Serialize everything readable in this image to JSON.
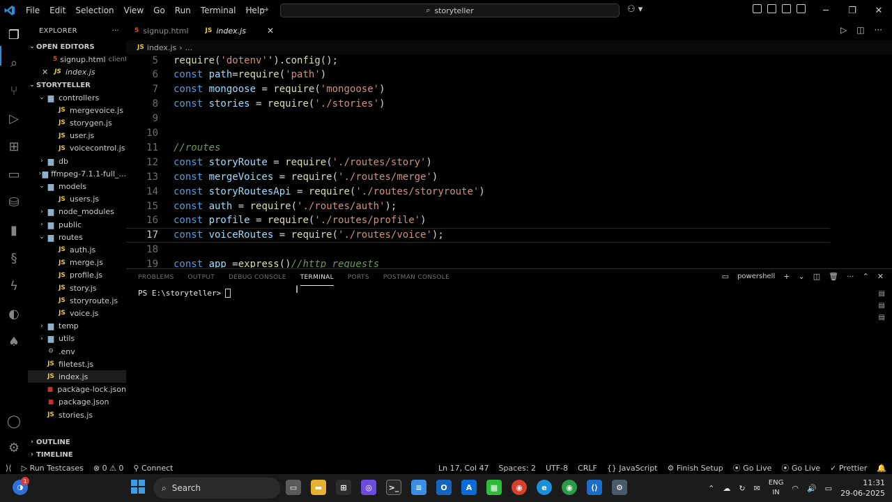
{
  "titlebar": {
    "menu": [
      "File",
      "Edit",
      "Selection",
      "View",
      "Go",
      "Run",
      "Terminal",
      "Help"
    ],
    "search": "storyteller"
  },
  "sidebar": {
    "title": "EXPLORER",
    "open_editors_label": "OPEN EDITORS",
    "open_editors": [
      {
        "name": "signup.html",
        "hint": "client"
      },
      {
        "name": "index.js",
        "hint": ""
      }
    ],
    "project_label": "STORYTELLER",
    "tree": [
      {
        "label": "controllers",
        "type": "folder",
        "open": true,
        "depth": 1
      },
      {
        "label": "mergevoice.js",
        "type": "js",
        "depth": 2
      },
      {
        "label": "storygen.js",
        "type": "js",
        "depth": 2
      },
      {
        "label": "user.js",
        "type": "js",
        "depth": 2
      },
      {
        "label": "voicecontrol.js",
        "type": "js",
        "depth": 2
      },
      {
        "label": "db",
        "type": "folder",
        "open": false,
        "depth": 1
      },
      {
        "label": "ffmpeg-7.1.1-full_...",
        "type": "folder",
        "open": false,
        "depth": 1
      },
      {
        "label": "models",
        "type": "folder",
        "open": true,
        "depth": 1
      },
      {
        "label": "users.js",
        "type": "js",
        "depth": 2
      },
      {
        "label": "node_modules",
        "type": "folder",
        "open": false,
        "depth": 1
      },
      {
        "label": "public",
        "type": "folder",
        "open": false,
        "depth": 1
      },
      {
        "label": "routes",
        "type": "folder",
        "open": true,
        "depth": 1
      },
      {
        "label": "auth.js",
        "type": "js",
        "depth": 2
      },
      {
        "label": "merge.js",
        "type": "js",
        "depth": 2
      },
      {
        "label": "profile.js",
        "type": "js",
        "depth": 2
      },
      {
        "label": "story.js",
        "type": "js",
        "depth": 2
      },
      {
        "label": "storyroute.js",
        "type": "js",
        "depth": 2
      },
      {
        "label": "voice.js",
        "type": "js",
        "depth": 2
      },
      {
        "label": "temp",
        "type": "folder",
        "open": false,
        "depth": 1
      },
      {
        "label": "utils",
        "type": "folder",
        "open": false,
        "depth": 1
      },
      {
        "label": ".env",
        "type": "env",
        "depth": 1
      },
      {
        "label": "filetest.js",
        "type": "js",
        "depth": 1
      },
      {
        "label": "index.js",
        "type": "js",
        "depth": 1,
        "selected": true
      },
      {
        "label": "package-lock.json",
        "type": "json",
        "depth": 1
      },
      {
        "label": "package.json",
        "type": "json",
        "depth": 1
      },
      {
        "label": "stories.js",
        "type": "js",
        "depth": 1
      }
    ],
    "outline_label": "OUTLINE",
    "timeline_label": "TIMELINE"
  },
  "tabs": [
    {
      "label": "signup.html",
      "active": false
    },
    {
      "label": "index.js",
      "active": true
    }
  ],
  "breadcrumb": {
    "file": "index.js",
    "more": "..."
  },
  "editor": {
    "current_line": 17,
    "lines": [
      {
        "n": 5,
        "tokens": [
          [
            "fn",
            "require"
          ],
          [
            "p",
            "("
          ],
          [
            "str",
            "'dotenv'"
          ],
          [
            "p",
            "')."
          ],
          [
            "fn",
            "config"
          ],
          [
            "p",
            "();"
          ]
        ]
      },
      {
        "n": 6,
        "tokens": [
          [
            "kw",
            "const "
          ],
          [
            "var",
            "path"
          ],
          [
            "p",
            "="
          ],
          [
            "fn",
            "require"
          ],
          [
            "p",
            "("
          ],
          [
            "str",
            "'path'"
          ],
          [
            "p",
            ")"
          ]
        ]
      },
      {
        "n": 7,
        "tokens": [
          [
            "kw",
            "const "
          ],
          [
            "var",
            "mongoose"
          ],
          [
            "p",
            " = "
          ],
          [
            "fn",
            "require"
          ],
          [
            "p",
            "("
          ],
          [
            "str",
            "'mongoose'"
          ],
          [
            "p",
            ")"
          ]
        ]
      },
      {
        "n": 8,
        "tokens": [
          [
            "kw",
            "const "
          ],
          [
            "var",
            "stories"
          ],
          [
            "p",
            " = "
          ],
          [
            "fn",
            "require"
          ],
          [
            "p",
            "("
          ],
          [
            "str",
            "'./stories'"
          ],
          [
            "p",
            ")"
          ]
        ]
      },
      {
        "n": 9,
        "tokens": []
      },
      {
        "n": 10,
        "tokens": []
      },
      {
        "n": 11,
        "tokens": [
          [
            "cmt",
            "//routes"
          ]
        ]
      },
      {
        "n": 12,
        "tokens": [
          [
            "kw",
            "const "
          ],
          [
            "var",
            "storyRoute"
          ],
          [
            "p",
            " = "
          ],
          [
            "fn",
            "require"
          ],
          [
            "p",
            "("
          ],
          [
            "str",
            "'./routes/story'"
          ],
          [
            "p",
            ")"
          ]
        ]
      },
      {
        "n": 13,
        "tokens": [
          [
            "kw",
            "const "
          ],
          [
            "var",
            "mergeVoices"
          ],
          [
            "p",
            " = "
          ],
          [
            "fn",
            "require"
          ],
          [
            "p",
            "("
          ],
          [
            "str",
            "'./routes/merge'"
          ],
          [
            "p",
            ")"
          ]
        ]
      },
      {
        "n": 14,
        "tokens": [
          [
            "kw",
            "const "
          ],
          [
            "var",
            "storyRoutesApi"
          ],
          [
            "p",
            " = "
          ],
          [
            "fn",
            "require"
          ],
          [
            "p",
            "("
          ],
          [
            "str",
            "'./routes/storyroute'"
          ],
          [
            "p",
            ")"
          ]
        ]
      },
      {
        "n": 15,
        "tokens": [
          [
            "kw",
            "const "
          ],
          [
            "var",
            "auth"
          ],
          [
            "p",
            " = "
          ],
          [
            "fn",
            "require"
          ],
          [
            "p",
            "("
          ],
          [
            "str",
            "'./routes/auth'"
          ],
          [
            "p",
            ");"
          ]
        ]
      },
      {
        "n": 16,
        "tokens": [
          [
            "kw",
            "const "
          ],
          [
            "var",
            "profile"
          ],
          [
            "p",
            " = "
          ],
          [
            "fn",
            "require"
          ],
          [
            "p",
            "("
          ],
          [
            "str",
            "'./routes/profile'"
          ],
          [
            "p",
            ")"
          ]
        ]
      },
      {
        "n": 17,
        "tokens": [
          [
            "kw",
            "const "
          ],
          [
            "var",
            "voiceRoutes"
          ],
          [
            "p",
            " = "
          ],
          [
            "fn",
            "require"
          ],
          [
            "p",
            "("
          ],
          [
            "str",
            "'./routes/voice'"
          ],
          [
            "p",
            ");"
          ]
        ]
      },
      {
        "n": 18,
        "tokens": []
      },
      {
        "n": 19,
        "tokens": [
          [
            "kw",
            "const "
          ],
          [
            "var",
            "app"
          ],
          [
            "p",
            " ="
          ],
          [
            "fn",
            "express"
          ],
          [
            "p",
            "()"
          ],
          [
            "cmt",
            "//http requests"
          ]
        ]
      }
    ]
  },
  "panel": {
    "tabs": [
      "PROBLEMS",
      "OUTPUT",
      "DEBUG CONSOLE",
      "TERMINAL",
      "PORTS",
      "POSTMAN CONSOLE"
    ],
    "active_tab": "TERMINAL",
    "shell": "powershell",
    "prompt": "PS E:\\storyteller>"
  },
  "statusbar": {
    "run_testcases": "Run Testcases",
    "errors": "0",
    "warnings": "0",
    "connect": "Connect",
    "position": "Ln 17, Col 47",
    "spaces": "Spaces: 2",
    "encoding": "UTF-8",
    "eol": "CRLF",
    "language": "JavaScript",
    "finish_setup": "Finish Setup",
    "go_live_1": "Go Live",
    "go_live_2": "Go Live",
    "prettier": "Prettier"
  },
  "taskbar": {
    "search": "Search",
    "notification_count": "1",
    "lang_top": "ENG",
    "lang_bottom": "IN",
    "time": "11:31",
    "date": "29-06-2025"
  },
  "colors": {
    "keyword": "#569cd6",
    "function": "#dcdcaa",
    "string": "#ce9178",
    "variable": "#9cdcfe",
    "comment": "#6a9955",
    "accent": "#2a8fd8"
  }
}
